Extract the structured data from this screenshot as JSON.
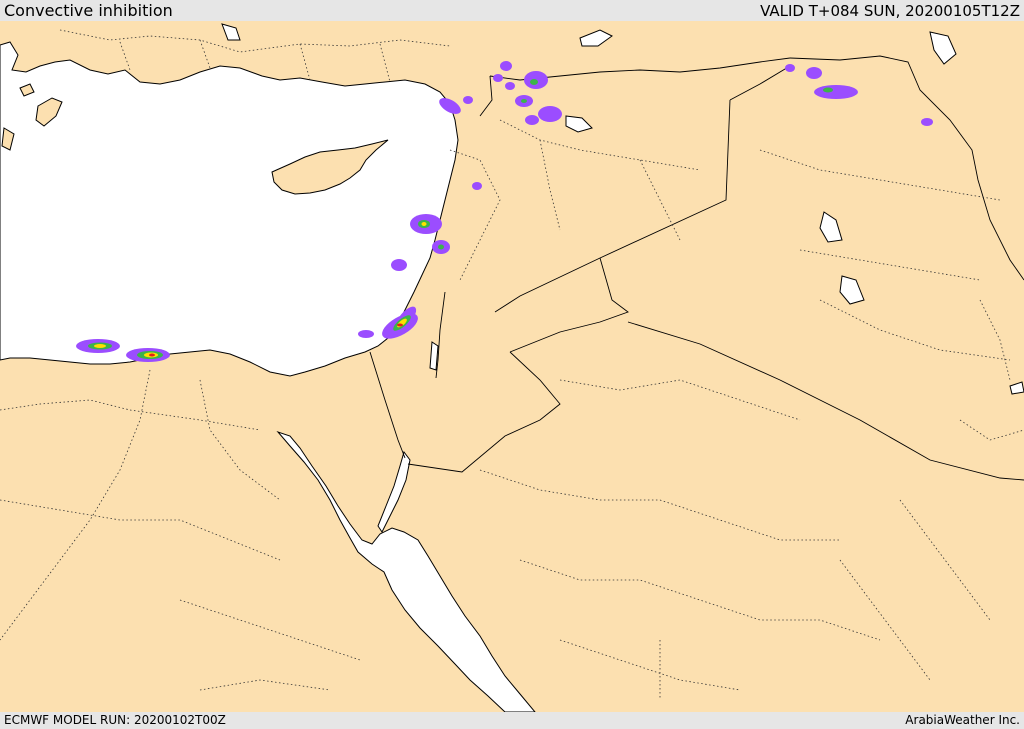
{
  "header": {
    "title": "Convective inhibition",
    "valid_time": "VALID T+084 SUN, 20200105T12Z"
  },
  "footer": {
    "model_run": "ECMWF MODEL RUN: 20200102T00Z",
    "credit": "ArabiaWeather Inc."
  },
  "colors": {
    "land": "#fce0b0",
    "water": "#ffffff",
    "coast": "#000000",
    "cin_low": "#9b4dff",
    "cin_mid": "#3cb44b",
    "cin_high": "#ffe000",
    "cin_max": "#e0201a"
  }
}
